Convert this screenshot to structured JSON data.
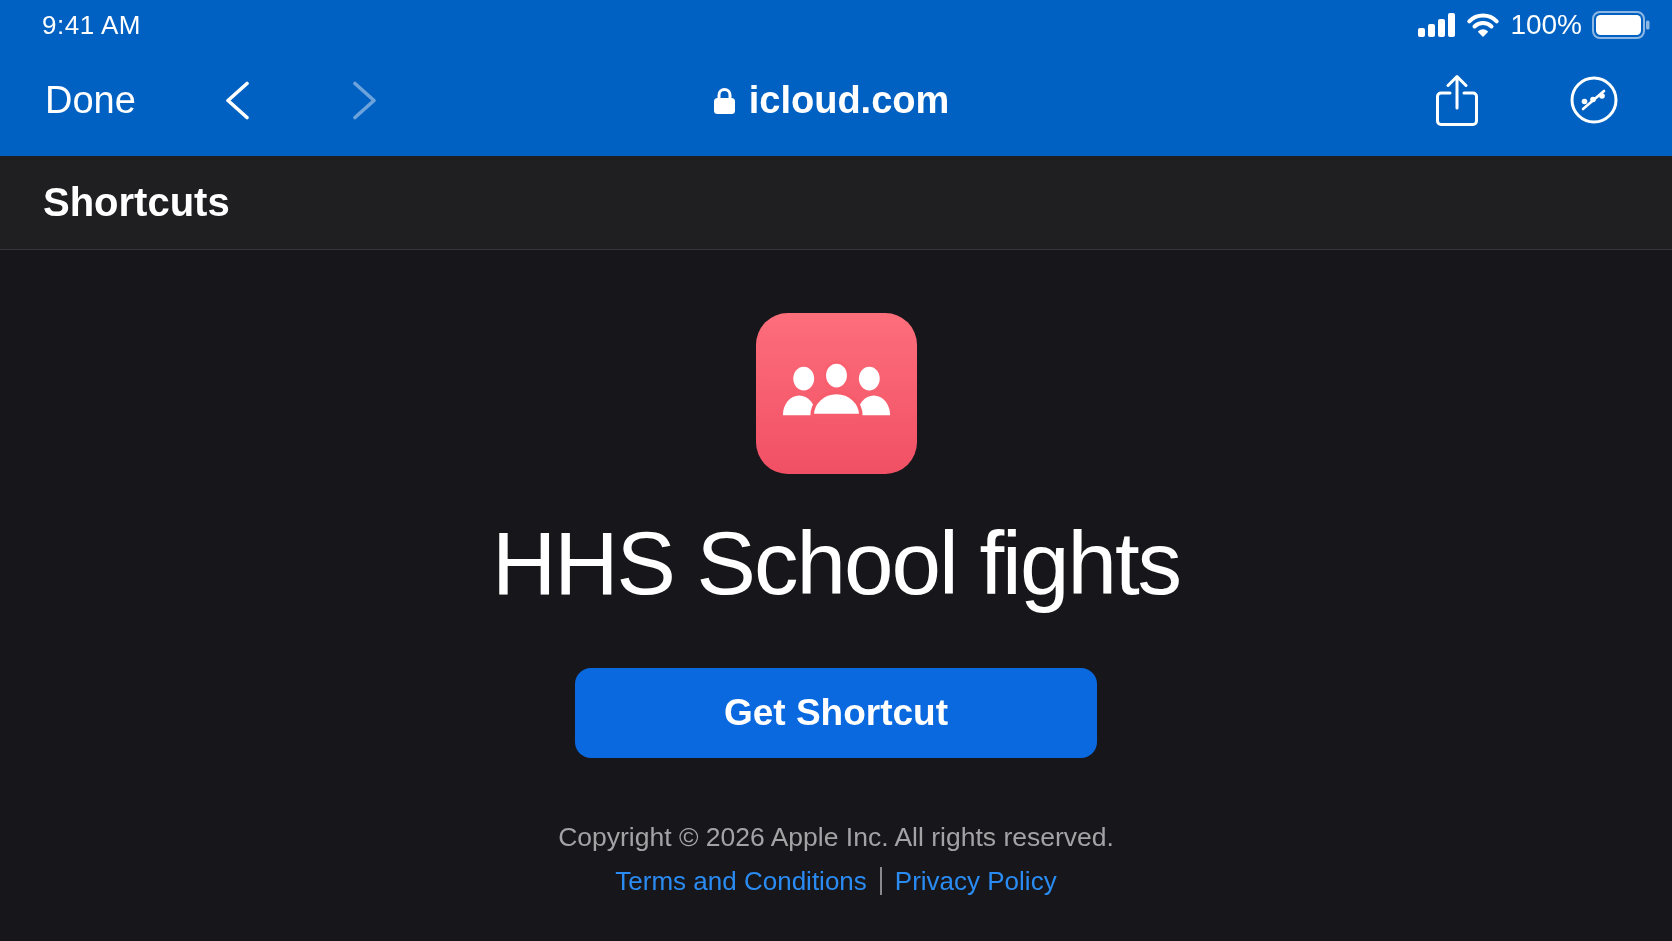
{
  "status_bar": {
    "time": "9:41 AM",
    "battery": "100%"
  },
  "browser": {
    "done": "Done",
    "nav_buttons": [
      {
        "kind": "back",
        "disabled": false
      },
      {
        "kind": "forward",
        "disabled": true
      }
    ],
    "secure": true,
    "address": "icloud.com"
  },
  "header": {
    "title": "Shortcuts"
  },
  "shortcut": {
    "name": "HHS School fights",
    "button": "Get Shortcut"
  },
  "footer": {
    "copyright": "Copyright © 2026 Apple Inc. All rights reserved.",
    "links": [
      "Terms and Conditions",
      "Privacy Policy"
    ]
  }
}
